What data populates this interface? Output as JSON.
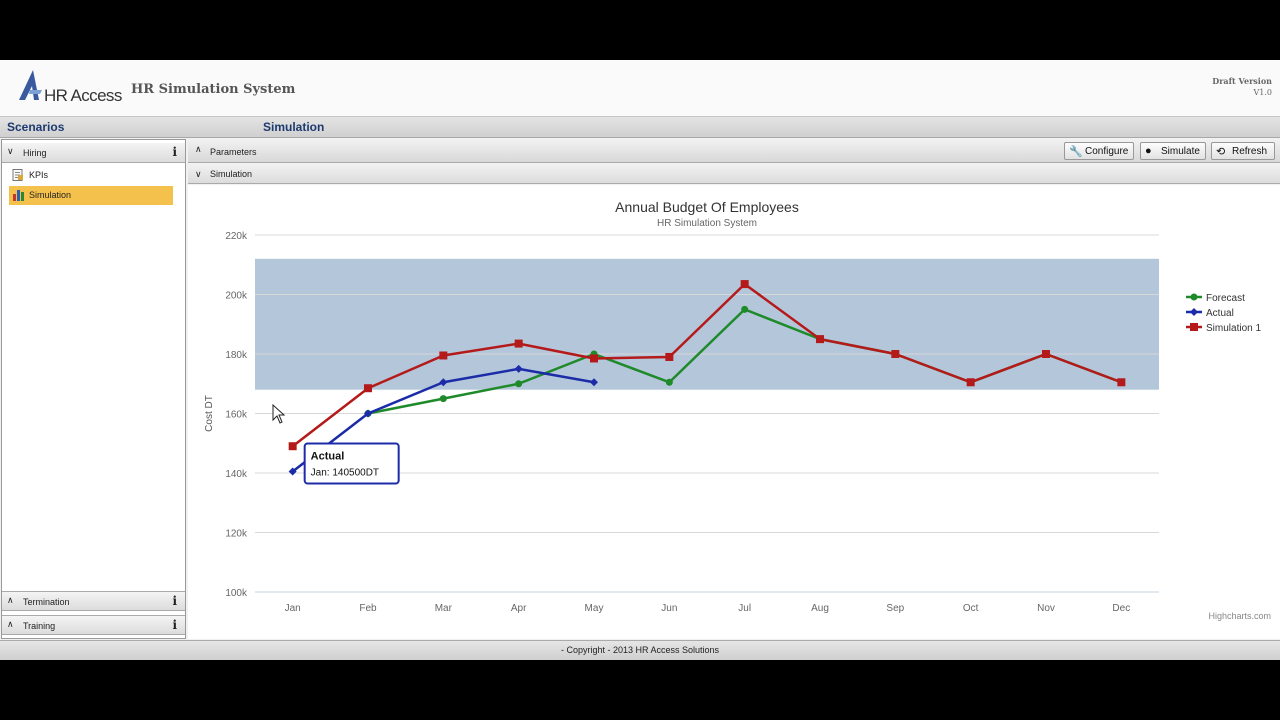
{
  "header": {
    "logo_text": "HR Access",
    "app_title": "HR Simulation System",
    "version_label": "Draft Version",
    "version_number": "V1.0"
  },
  "sections": {
    "left_title": "Scenarios",
    "right_title": "Simulation"
  },
  "left_panel": {
    "groups": [
      {
        "label": "Hiring",
        "expanded": true,
        "info": "i"
      },
      {
        "label": "Termination",
        "expanded": true,
        "info": "i"
      },
      {
        "label": "Training",
        "expanded": true,
        "info": "i"
      }
    ],
    "items": [
      {
        "label": "KPIs",
        "active": false,
        "icon": "document-icon"
      },
      {
        "label": "Simulation",
        "active": true,
        "icon": "bar-chart-icon"
      }
    ]
  },
  "main": {
    "parameters_label": "Parameters",
    "simulation_label": "Simulation",
    "toolbar": {
      "configure": "Configure",
      "simulate": "Simulate",
      "refresh": "Refresh"
    }
  },
  "chart_data": {
    "type": "line",
    "title": "Annual Budget Of Employees",
    "subtitle": "HR Simulation System",
    "ylabel": "Cost DT",
    "xlabel": "",
    "categories": [
      "Jan",
      "Feb",
      "Mar",
      "Apr",
      "May",
      "Jun",
      "Jul",
      "Aug",
      "Sep",
      "Oct",
      "Nov",
      "Dec"
    ],
    "y_ticks": [
      100000,
      120000,
      140000,
      160000,
      180000,
      200000,
      220000
    ],
    "y_tick_labels": [
      "100k",
      "120k",
      "140k",
      "160k",
      "180k",
      "200k",
      "220k"
    ],
    "ylim": [
      100000,
      220000
    ],
    "plot_band": [
      168000,
      212000
    ],
    "plot_band_color": "#b4c6da",
    "grid": true,
    "legend_position": "right",
    "series": [
      {
        "name": "Forecast",
        "color": "#1e8a2a",
        "marker": "circle",
        "values": [
          null,
          160000,
          165000,
          170000,
          180000,
          170500,
          195000,
          185000,
          180000,
          170500,
          180000,
          170500
        ]
      },
      {
        "name": "Actual",
        "color": "#1c2ca8",
        "marker": "diamond",
        "values": [
          140500,
          160000,
          170500,
          175000,
          170500,
          null,
          null,
          null,
          null,
          null,
          null,
          null
        ]
      },
      {
        "name": "Simulation 1",
        "color": "#b51a1a",
        "marker": "square",
        "values": [
          149000,
          168500,
          179500,
          183500,
          178500,
          179000,
          203500,
          185000,
          180000,
          170500,
          180000,
          170500
        ]
      }
    ],
    "tooltip": {
      "title": "Actual",
      "text": "Jan: 140500DT",
      "series_index": 1,
      "point_index": 0
    },
    "credits": "Highcharts.com"
  },
  "footer": {
    "copyright": "- Copyright - 2013 HR Access Solutions"
  }
}
